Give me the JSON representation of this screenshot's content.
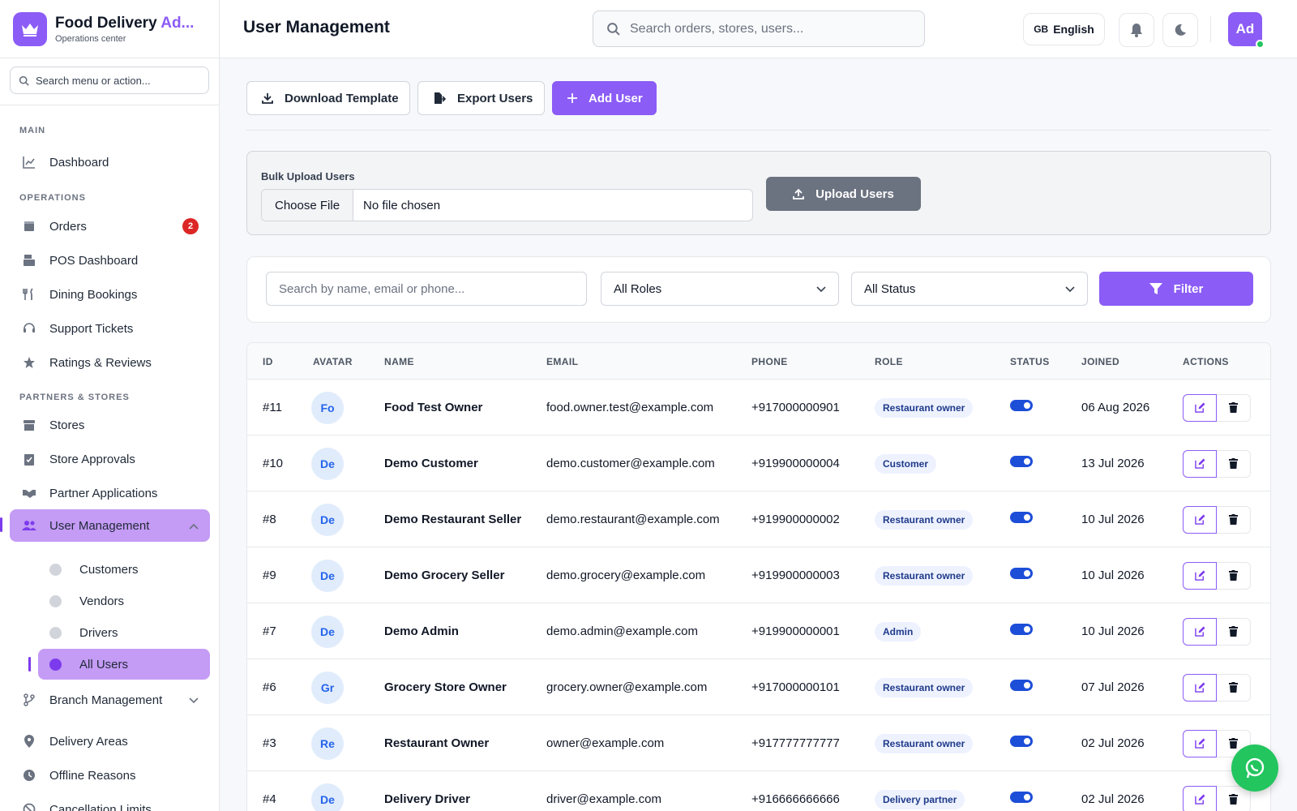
{
  "brand": {
    "title_main": "Food Delivery ",
    "title_accent": "Ad...",
    "subtitle": "Operations center"
  },
  "sidebar": {
    "search_placeholder": "Search menu or action...",
    "sections": {
      "main": "MAIN",
      "operations": "OPERATIONS",
      "partners": "PARTNERS & STORES"
    },
    "items": {
      "dashboard": "Dashboard",
      "orders": "Orders",
      "orders_badge": "2",
      "pos": "POS Dashboard",
      "dining": "Dining Bookings",
      "support": "Support Tickets",
      "ratings": "Ratings & Reviews",
      "stores": "Stores",
      "store_approvals": "Store Approvals",
      "partner_apps": "Partner Applications",
      "user_mgmt": "User Management",
      "branch_mgmt": "Branch Management",
      "delivery_areas": "Delivery Areas",
      "offline_reasons": "Offline Reasons",
      "cancellation": "Cancellation Limits"
    },
    "sub_items": [
      "Customers",
      "Vendors",
      "Drivers",
      "All Users"
    ]
  },
  "header": {
    "title": "User Management",
    "search_placeholder": "Search orders, stores, users...",
    "lang_flag": "GB",
    "lang": "English",
    "avatar": "Ad"
  },
  "toolbar": {
    "download": "Download Template",
    "export": "Export Users",
    "add": "Add User"
  },
  "bulk_upload": {
    "label": "Bulk Upload Users",
    "choose": "Choose File",
    "no_file": "No file chosen",
    "button": "Upload Users"
  },
  "filters": {
    "search_placeholder": "Search by name, email or phone...",
    "role": "All Roles",
    "status": "All Status",
    "button": "Filter"
  },
  "table": {
    "headers": [
      "ID",
      "AVATAR",
      "NAME",
      "EMAIL",
      "PHONE",
      "ROLE",
      "STATUS",
      "JOINED",
      "ACTIONS"
    ],
    "rows": [
      {
        "id": "#11",
        "avatar": "Fo",
        "name": "Food Test Owner",
        "email": "food.owner.test@example.com",
        "phone": "+917000000901",
        "role": "Restaurant owner",
        "joined": "06 Aug 2026"
      },
      {
        "id": "#10",
        "avatar": "De",
        "name": "Demo Customer",
        "email": "demo.customer@example.com",
        "phone": "+919900000004",
        "role": "Customer",
        "joined": "13 Jul 2026"
      },
      {
        "id": "#8",
        "avatar": "De",
        "name": "Demo Restaurant Seller",
        "email": "demo.restaurant@example.com",
        "phone": "+919900000002",
        "role": "Restaurant owner",
        "joined": "10 Jul 2026"
      },
      {
        "id": "#9",
        "avatar": "De",
        "name": "Demo Grocery Seller",
        "email": "demo.grocery@example.com",
        "phone": "+919900000003",
        "role": "Restaurant owner",
        "joined": "10 Jul 2026"
      },
      {
        "id": "#7",
        "avatar": "De",
        "name": "Demo Admin",
        "email": "demo.admin@example.com",
        "phone": "+919900000001",
        "role": "Admin",
        "joined": "10 Jul 2026"
      },
      {
        "id": "#6",
        "avatar": "Gr",
        "name": "Grocery Store Owner",
        "email": "grocery.owner@example.com",
        "phone": "+917000000101",
        "role": "Restaurant owner",
        "joined": "07 Jul 2026"
      },
      {
        "id": "#3",
        "avatar": "Re",
        "name": "Restaurant Owner",
        "email": "owner@example.com",
        "phone": "+917777777777",
        "role": "Restaurant owner",
        "joined": "02 Jul 2026"
      },
      {
        "id": "#4",
        "avatar": "De",
        "name": "Delivery Driver",
        "email": "driver@example.com",
        "phone": "+916666666666",
        "role": "Delivery partner",
        "joined": "02 Jul 2026"
      }
    ]
  },
  "colors": {
    "accent": "#8b5cf6",
    "accent_soft": "#c49bf5",
    "badge": "#dc2626",
    "toggle": "#1d4ed8",
    "whatsapp": "#22c55e"
  }
}
